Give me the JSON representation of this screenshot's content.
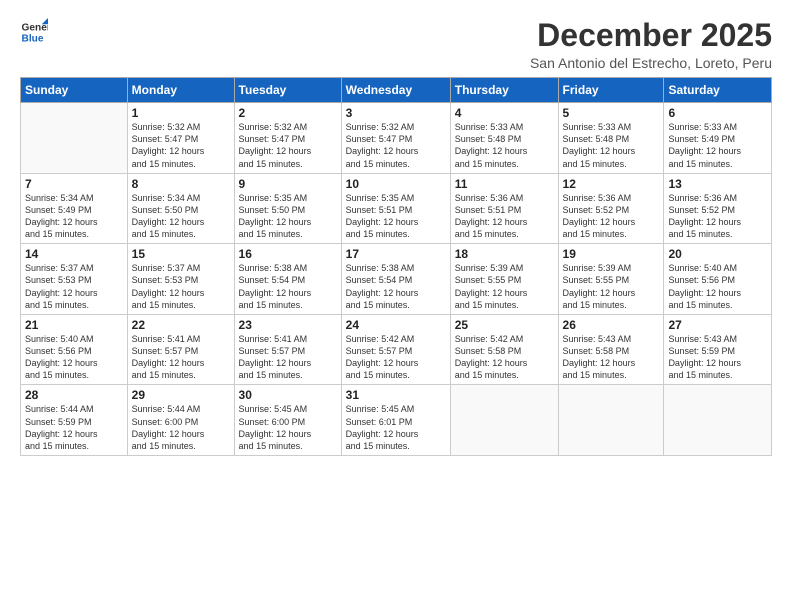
{
  "logo": {
    "line1": "General",
    "line2": "Blue"
  },
  "title": "December 2025",
  "subtitle": "San Antonio del Estrecho, Loreto, Peru",
  "header": {
    "days": [
      "Sunday",
      "Monday",
      "Tuesday",
      "Wednesday",
      "Thursday",
      "Friday",
      "Saturday"
    ]
  },
  "weeks": [
    [
      {
        "day": "",
        "info": ""
      },
      {
        "day": "1",
        "info": "Sunrise: 5:32 AM\nSunset: 5:47 PM\nDaylight: 12 hours\nand 15 minutes."
      },
      {
        "day": "2",
        "info": "Sunrise: 5:32 AM\nSunset: 5:47 PM\nDaylight: 12 hours\nand 15 minutes."
      },
      {
        "day": "3",
        "info": "Sunrise: 5:32 AM\nSunset: 5:47 PM\nDaylight: 12 hours\nand 15 minutes."
      },
      {
        "day": "4",
        "info": "Sunrise: 5:33 AM\nSunset: 5:48 PM\nDaylight: 12 hours\nand 15 minutes."
      },
      {
        "day": "5",
        "info": "Sunrise: 5:33 AM\nSunset: 5:48 PM\nDaylight: 12 hours\nand 15 minutes."
      },
      {
        "day": "6",
        "info": "Sunrise: 5:33 AM\nSunset: 5:49 PM\nDaylight: 12 hours\nand 15 minutes."
      }
    ],
    [
      {
        "day": "7",
        "info": "Sunrise: 5:34 AM\nSunset: 5:49 PM\nDaylight: 12 hours\nand 15 minutes."
      },
      {
        "day": "8",
        "info": "Sunrise: 5:34 AM\nSunset: 5:50 PM\nDaylight: 12 hours\nand 15 minutes."
      },
      {
        "day": "9",
        "info": "Sunrise: 5:35 AM\nSunset: 5:50 PM\nDaylight: 12 hours\nand 15 minutes."
      },
      {
        "day": "10",
        "info": "Sunrise: 5:35 AM\nSunset: 5:51 PM\nDaylight: 12 hours\nand 15 minutes."
      },
      {
        "day": "11",
        "info": "Sunrise: 5:36 AM\nSunset: 5:51 PM\nDaylight: 12 hours\nand 15 minutes."
      },
      {
        "day": "12",
        "info": "Sunrise: 5:36 AM\nSunset: 5:52 PM\nDaylight: 12 hours\nand 15 minutes."
      },
      {
        "day": "13",
        "info": "Sunrise: 5:36 AM\nSunset: 5:52 PM\nDaylight: 12 hours\nand 15 minutes."
      }
    ],
    [
      {
        "day": "14",
        "info": "Sunrise: 5:37 AM\nSunset: 5:53 PM\nDaylight: 12 hours\nand 15 minutes."
      },
      {
        "day": "15",
        "info": "Sunrise: 5:37 AM\nSunset: 5:53 PM\nDaylight: 12 hours\nand 15 minutes."
      },
      {
        "day": "16",
        "info": "Sunrise: 5:38 AM\nSunset: 5:54 PM\nDaylight: 12 hours\nand 15 minutes."
      },
      {
        "day": "17",
        "info": "Sunrise: 5:38 AM\nSunset: 5:54 PM\nDaylight: 12 hours\nand 15 minutes."
      },
      {
        "day": "18",
        "info": "Sunrise: 5:39 AM\nSunset: 5:55 PM\nDaylight: 12 hours\nand 15 minutes."
      },
      {
        "day": "19",
        "info": "Sunrise: 5:39 AM\nSunset: 5:55 PM\nDaylight: 12 hours\nand 15 minutes."
      },
      {
        "day": "20",
        "info": "Sunrise: 5:40 AM\nSunset: 5:56 PM\nDaylight: 12 hours\nand 15 minutes."
      }
    ],
    [
      {
        "day": "21",
        "info": "Sunrise: 5:40 AM\nSunset: 5:56 PM\nDaylight: 12 hours\nand 15 minutes."
      },
      {
        "day": "22",
        "info": "Sunrise: 5:41 AM\nSunset: 5:57 PM\nDaylight: 12 hours\nand 15 minutes."
      },
      {
        "day": "23",
        "info": "Sunrise: 5:41 AM\nSunset: 5:57 PM\nDaylight: 12 hours\nand 15 minutes."
      },
      {
        "day": "24",
        "info": "Sunrise: 5:42 AM\nSunset: 5:57 PM\nDaylight: 12 hours\nand 15 minutes."
      },
      {
        "day": "25",
        "info": "Sunrise: 5:42 AM\nSunset: 5:58 PM\nDaylight: 12 hours\nand 15 minutes."
      },
      {
        "day": "26",
        "info": "Sunrise: 5:43 AM\nSunset: 5:58 PM\nDaylight: 12 hours\nand 15 minutes."
      },
      {
        "day": "27",
        "info": "Sunrise: 5:43 AM\nSunset: 5:59 PM\nDaylight: 12 hours\nand 15 minutes."
      }
    ],
    [
      {
        "day": "28",
        "info": "Sunrise: 5:44 AM\nSunset: 5:59 PM\nDaylight: 12 hours\nand 15 minutes."
      },
      {
        "day": "29",
        "info": "Sunrise: 5:44 AM\nSunset: 6:00 PM\nDaylight: 12 hours\nand 15 minutes."
      },
      {
        "day": "30",
        "info": "Sunrise: 5:45 AM\nSunset: 6:00 PM\nDaylight: 12 hours\nand 15 minutes."
      },
      {
        "day": "31",
        "info": "Sunrise: 5:45 AM\nSunset: 6:01 PM\nDaylight: 12 hours\nand 15 minutes."
      },
      {
        "day": "",
        "info": ""
      },
      {
        "day": "",
        "info": ""
      },
      {
        "day": "",
        "info": ""
      }
    ]
  ]
}
